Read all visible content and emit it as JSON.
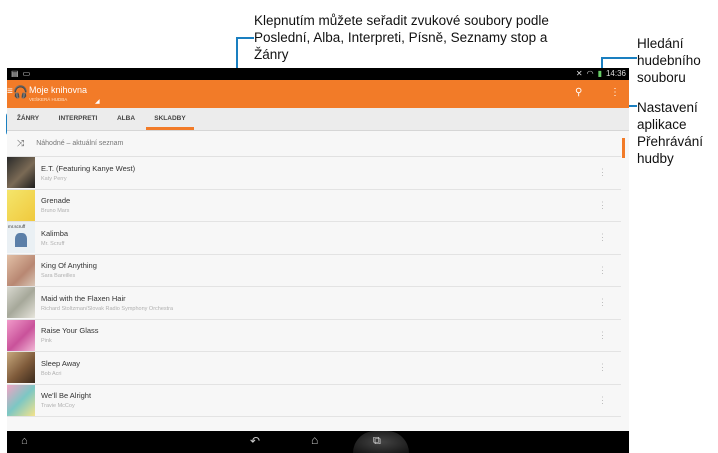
{
  "annotations": {
    "top": "Klepnutím můžete seřadit zvukové soubory podle Poslední, Alba, Interpreti, Písně, Seznamy stop a Žánry",
    "search": "Hledání hudebního souboru",
    "settings": "Nastavení aplikace Přehrávání hudby"
  },
  "status": {
    "time": "14:36"
  },
  "header": {
    "title": "Moje knihovna",
    "subtitle": "VEŠKERÁ HUDBA"
  },
  "tabs": [
    {
      "label": "ŽÁNRY",
      "active": false
    },
    {
      "label": "INTERPRETI",
      "active": false
    },
    {
      "label": "ALBA",
      "active": false
    },
    {
      "label": "SKLADBY",
      "active": true
    }
  ],
  "shuffle_label": "Náhodné – aktuální seznam",
  "songs": [
    {
      "title": "E.T. (Featuring Kanye West)",
      "artist": "Katy Perry"
    },
    {
      "title": "Grenade",
      "artist": "Bruno Mars"
    },
    {
      "title": "Kalimba",
      "artist": "Mr. Scruff",
      "art_text": "mr.scruff"
    },
    {
      "title": "King Of Anything",
      "artist": "Sara Bareilles"
    },
    {
      "title": "Maid with the Flaxen Hair",
      "artist": "Richard Stoltzman/Slovak Radio Symphony Orchestra"
    },
    {
      "title": "Raise Your Glass",
      "artist": "Pink"
    },
    {
      "title": "Sleep Away",
      "artist": "Bob Acri"
    },
    {
      "title": "We'll Be Alright",
      "artist": "Travie McCoy"
    }
  ],
  "colors": {
    "accent": "#f27b28",
    "callout": "#1a7fc0"
  },
  "icons": {
    "search": "search-icon",
    "menu": "overflow-menu-icon",
    "shuffle": "shuffle-icon",
    "back": "back-icon",
    "home": "home-icon",
    "recent": "recent-apps-icon"
  }
}
